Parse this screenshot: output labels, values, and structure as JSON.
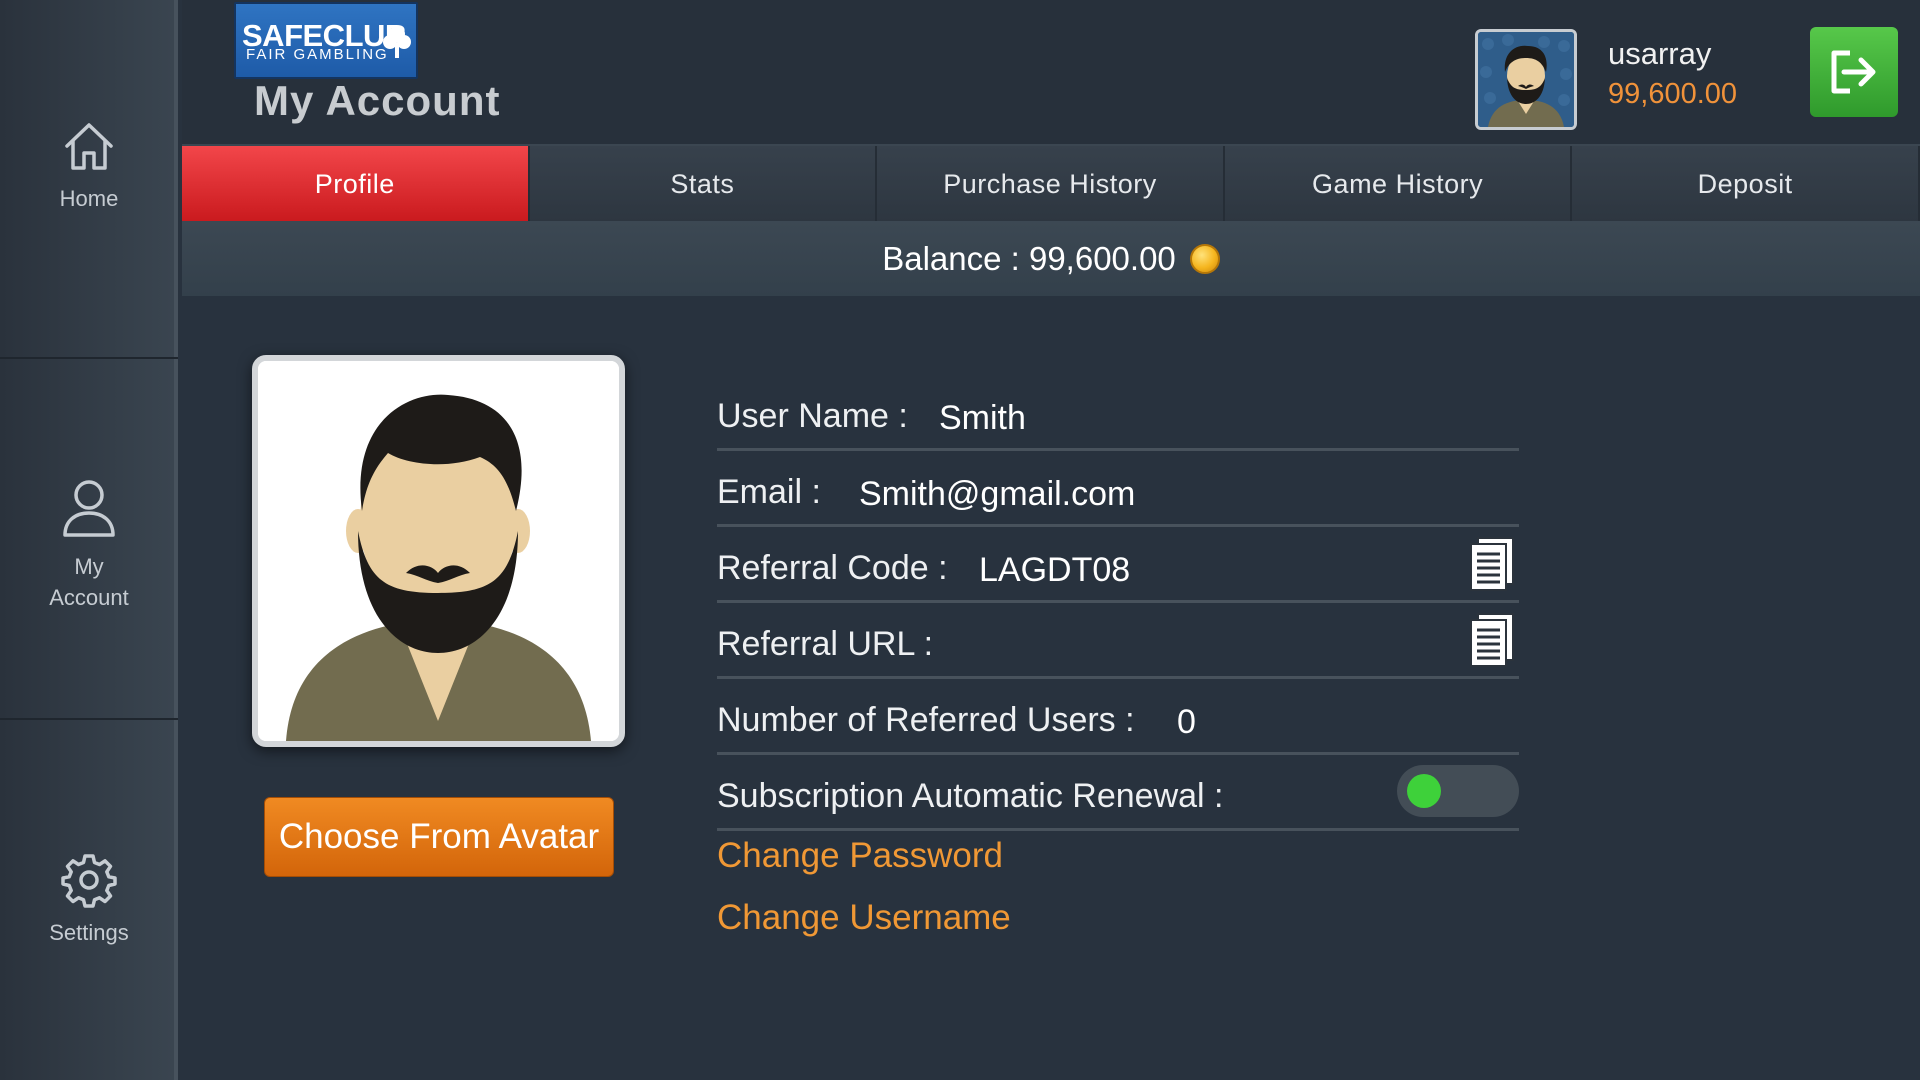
{
  "sidebar": {
    "items": [
      {
        "label": "Home"
      },
      {
        "label_line1": "My",
        "label_line2": "Account"
      },
      {
        "label": "Settings"
      }
    ]
  },
  "header": {
    "logo_main": "SAFECLUB",
    "logo_sub": "FAIR GAMBLING",
    "title": "My Account",
    "username": "usarray",
    "balance": "99,600.00"
  },
  "tabs": [
    {
      "label": "Profile",
      "active": true
    },
    {
      "label": "Stats"
    },
    {
      "label": "Purchase History"
    },
    {
      "label": "Game History"
    },
    {
      "label": "Deposit"
    }
  ],
  "balance_bar": {
    "text": "Balance : 99,600.00"
  },
  "avatar": {
    "button_label": "Choose From Avatar"
  },
  "profile": {
    "username_label": "User Name :",
    "username_value": "Smith",
    "email_label": "Email :",
    "email_value": "Smith@gmail.com",
    "referral_code_label": "Referral Code :",
    "referral_code_value": "LAGDT08",
    "referral_url_label": "Referral URL :",
    "referral_url_value": "",
    "referred_users_label": "Number of Referred Users :",
    "referred_users_value": "0",
    "auto_renewal_label": "Subscription Automatic Renewal :",
    "auto_renewal_on": true
  },
  "links": {
    "change_password": "Change Password",
    "change_username": "Change Username"
  },
  "colors": {
    "accent_orange": "#f09835",
    "active_tab_red": "#e0272b",
    "toggle_green": "#3ed13a",
    "logout_green": "#3fae36"
  },
  "icons": [
    "home-icon",
    "user-icon",
    "gear-icon",
    "logout-icon",
    "copy-icon",
    "coin-icon"
  ]
}
